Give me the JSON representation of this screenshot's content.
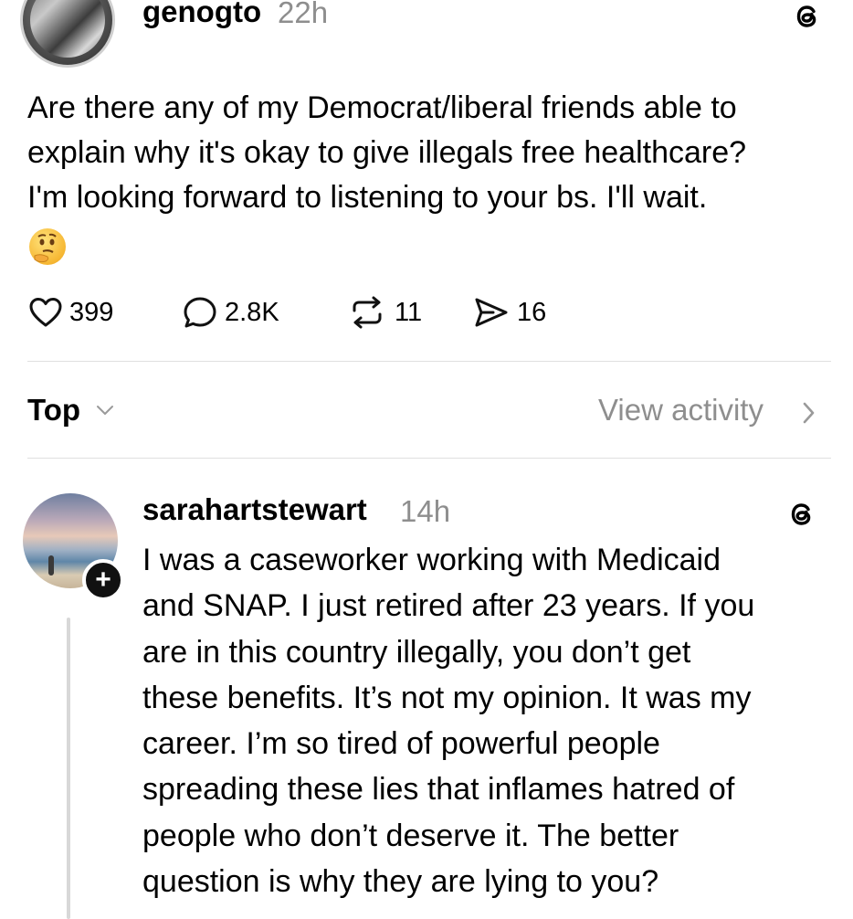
{
  "post": {
    "username": "genogto",
    "time": "22h",
    "text": "Are there any of my Democrat/liberal friends able to\nexplain why it's okay to give illegals free healthcare?\nI'm looking forward to listening to your bs. I'll wait.",
    "emoji": "thinking-face-emoji",
    "likes": "399",
    "comments": "2.8K",
    "reposts": "11",
    "shares": "16"
  },
  "replies_header": {
    "sort_label": "Top",
    "view_activity_label": "View activity"
  },
  "reply": {
    "username": "sarahartstewart",
    "time": "14h",
    "text": "I was a caseworker working with Medicaid\nand SNAP. I just retired after 23 years. If you\nare in this country illegally, you don’t get\nthese benefits. It’s not my opinion. It was my\ncareer. I’m so tired of powerful people\nspreading these lies that inflames hatred of\npeople who don’t deserve it. The better\nquestion is why they are lying to you?",
    "follow_badge": "+"
  },
  "icons": {
    "like": "heart-icon",
    "comment": "comment-bubble-icon",
    "repost": "repost-icon",
    "share": "send-icon",
    "brand": "threads-logo-icon"
  },
  "colors": {
    "text": "#000000",
    "muted": "#8e8e8e",
    "divider": "#e0e0e0"
  }
}
